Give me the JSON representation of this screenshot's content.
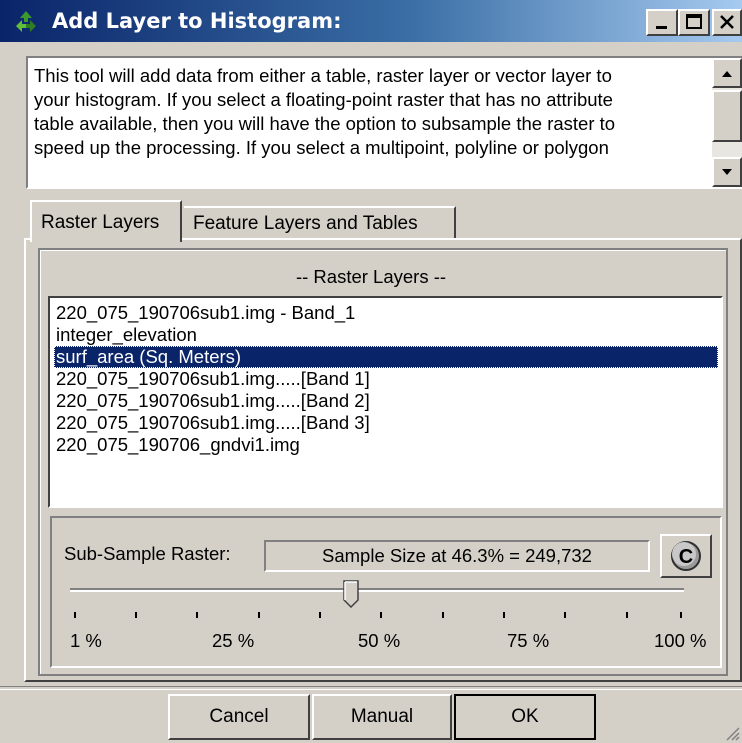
{
  "window": {
    "title": "Add Layer to Histogram:",
    "icon": "recycle-arrows-icon",
    "controls": [
      "minimize",
      "maximize",
      "close"
    ]
  },
  "description": {
    "text": "This tool will add data from either a table, raster layer or vector layer to\nyour histogram.  If you select a floating-point raster that has no attribute\ntable available, then you will have the option to subsample the raster to\nspeed up the processing.  If you select a multipoint, polyline or polygon"
  },
  "tabs": [
    {
      "label": "Raster Layers",
      "active": true
    },
    {
      "label": "Feature Layers and Tables",
      "active": false
    }
  ],
  "raster_group": {
    "title": "-- Raster Layers --",
    "items": [
      {
        "label": "220_075_190706sub1.img - Band_1",
        "selected": false
      },
      {
        "label": "integer_elevation",
        "selected": false
      },
      {
        "label": "surf_area  (Sq. Meters)",
        "selected": true
      },
      {
        "label": "220_075_190706sub1.img.....[Band 1]",
        "selected": false
      },
      {
        "label": "220_075_190706sub1.img.....[Band 2]",
        "selected": false
      },
      {
        "label": "220_075_190706sub1.img.....[Band 3]",
        "selected": false
      },
      {
        "label": "220_075_190706_gndvi1.img",
        "selected": false
      }
    ]
  },
  "subsample": {
    "label": "Sub-Sample Raster:",
    "sample_text": "Sample Size at 46.3% = 249,732",
    "button_label": "C",
    "slider_percent": 46.3,
    "scale_labels": [
      "1 %",
      "25 %",
      "50 %",
      "75 %",
      "100 %"
    ]
  },
  "buttons": {
    "cancel": "Cancel",
    "manual": "Manual",
    "ok": "OK"
  },
  "colors": {
    "titlebar_start": "#0a246a",
    "titlebar_end": "#a6caf0",
    "selection": "#0a246a",
    "face": "#d4d0c8"
  }
}
